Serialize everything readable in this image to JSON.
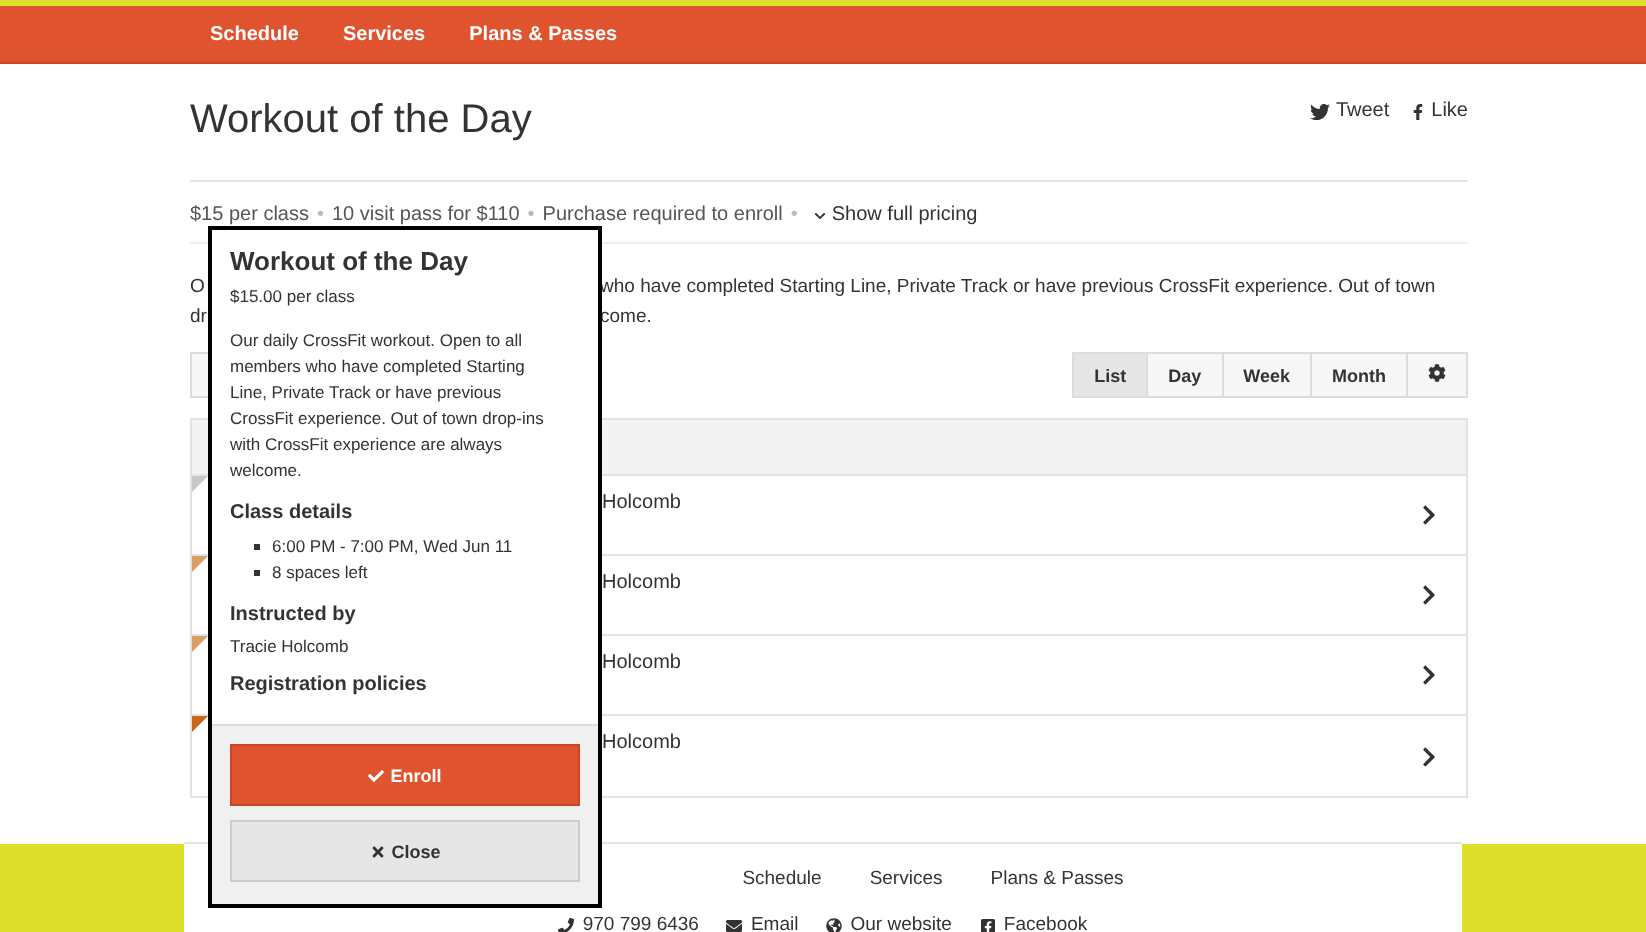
{
  "nav": {
    "items": [
      "Schedule",
      "Services",
      "Plans & Passes"
    ]
  },
  "header": {
    "title": "Workout of the Day",
    "share": [
      {
        "kind": "twitter",
        "label": "Tweet"
      },
      {
        "kind": "facebook",
        "label": "Like"
      }
    ]
  },
  "pricing": {
    "separator": "•",
    "items": [
      "$15 per class",
      "10 visit pass for $110",
      "Purchase required to enroll"
    ],
    "toggle": "Show full pricing"
  },
  "description": {
    "lines": [
      {
        "left": "O",
        "right": "who have completed Starting Line, Private Track or have previous CrossFit experience. Out of town"
      },
      {
        "left": "dr",
        "right": "come."
      }
    ]
  },
  "views": [
    {
      "label": "List",
      "selected": true
    },
    {
      "label": "Day",
      "selected": false
    },
    {
      "label": "Week",
      "selected": false
    },
    {
      "label": "Month",
      "selected": false
    }
  ],
  "rows": [
    {
      "instructor": "Holcomb",
      "color": "#c8c8c8"
    },
    {
      "instructor": "Holcomb",
      "color": "#d9a066"
    },
    {
      "instructor": "Holcomb",
      "color": "#d9a066"
    },
    {
      "instructor": "Holcomb",
      "color": "#c8661e"
    }
  ],
  "popover": {
    "title": "Workout of the Day",
    "price": "$15.00 per class",
    "description": "Our daily CrossFit workout. Open to all members who have completed Starting Line, Private Track or have previous CrossFit experience. Out of town drop-ins with CrossFit experience are always welcome.",
    "details_heading": "Class details",
    "details": [
      "6:00 PM - 7:00 PM, Wed Jun 11",
      "8 spaces left"
    ],
    "instructor_heading": "Instructed by",
    "instructor": "Tracie Holcomb",
    "policies_heading": "Registration policies",
    "enroll": "Enroll",
    "close": "Close"
  },
  "footer": {
    "links": [
      "Schedule",
      "Services",
      "Plans & Passes"
    ],
    "contacts": [
      {
        "kind": "phone",
        "label": "970 799 6436"
      },
      {
        "kind": "email",
        "label": "Email"
      },
      {
        "kind": "website",
        "label": "Our website"
      },
      {
        "kind": "facebook",
        "label": "Facebook"
      }
    ]
  }
}
